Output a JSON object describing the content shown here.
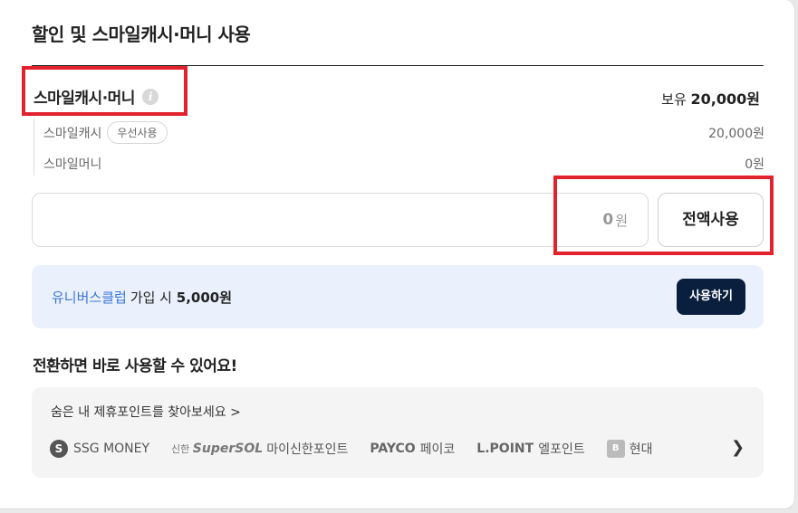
{
  "section": {
    "title": "할인 및 스마일캐시·머니 사용"
  },
  "smile": {
    "title": "스마일캐시·머니",
    "info_icon": "i",
    "balance_prefix": "보유",
    "balance_amount": "20,000원",
    "cash_label": "스마일캐시",
    "cash_badge": "우선사용",
    "cash_amount": "20,000원",
    "money_label": "스마일머니",
    "money_amount": "0원"
  },
  "amount_input": {
    "value": "0",
    "unit": "원"
  },
  "full_use_button": "전액사용",
  "promo": {
    "club_name": "유니버스클럽",
    "text_middle": "가입 시",
    "amount": "5,000원",
    "button": "사용하기"
  },
  "conversion": {
    "title": "전환하면 바로 사용할 수 있어요!",
    "link": "숨은 내 제휴포인트를 찾아보세요 >",
    "partners": {
      "ssg_icon": "S",
      "ssg": "SSG MONEY",
      "shinhan_prefix": "신한",
      "shinhan_brand": "SuperSOL",
      "shinhan": "마이신한포인트",
      "payco_brand": "PAYCO",
      "payco": "페이코",
      "lpoint_brand": "L.POINT",
      "lpoint": "엘포인트",
      "hyundai_icon": "B",
      "hyundai": "현대"
    },
    "next_icon": "chevron-right-icon"
  },
  "colors": {
    "highlight": "#e3222f",
    "promo_bg": "#eaf1fc",
    "club_blue": "#3a76d6",
    "button_dark": "#0a1f3d"
  }
}
